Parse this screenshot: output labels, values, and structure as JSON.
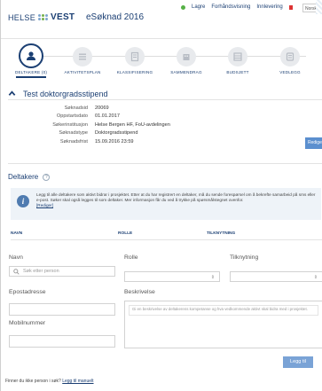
{
  "header": {
    "brand_left": "HELSE",
    "brand_right": "VEST",
    "app_title": "eSøknad 2016",
    "save": "Lagre",
    "preview": "Forhåndsvisning",
    "submit": "Innlevering",
    "language": "Norsk"
  },
  "steps": [
    {
      "label": "DELTAKERE (0)",
      "icon": "people-icon"
    },
    {
      "label": "AKTIVITETSPLAN",
      "icon": "list-icon"
    },
    {
      "label": "KLASSIFISERING",
      "icon": "document-icon"
    },
    {
      "label": "SAMMENDRAG",
      "icon": "building-icon"
    },
    {
      "label": "BUDSJETT",
      "icon": "table-icon"
    },
    {
      "label": "VEDLEGG",
      "icon": "attachment-icon"
    }
  ],
  "section": {
    "title": "Test doktorgradsstipend",
    "rows": [
      {
        "k": "Søknadsid",
        "v": "20069"
      },
      {
        "k": "Oppstartsdato",
        "v": "01.01.2017"
      },
      {
        "k": "Søkerinstitusjon",
        "v": "Helse Bergen HF, FoU-avdelingen"
      },
      {
        "k": "Søknadstype",
        "v": "Doktorgradsstipend"
      },
      {
        "k": "Søknadsfrist",
        "v": "15.09.2016 23:59"
      }
    ],
    "edit_button": "Rediger"
  },
  "participants": {
    "title": "Deltakere",
    "help": "?",
    "info_icon": "i",
    "info": "Legg til alle deltakere som aktivt bidrar i prosjektet. Etter at du har registrert en deltaker, må du sende forespørsel om å bekrefte samarbeid på sms eller e-post. Søker skal også legges til som deltaker. Mer informasjon får du ved å trykke på spørsmålstegnet ovenfor.",
    "info_link": "[Rediger]"
  },
  "table_headers": [
    "NAVN",
    "ROLLE",
    "TILKNYTNING"
  ],
  "form": {
    "name_label": "Navn",
    "name_placeholder": "Søk etter person",
    "role_label": "Rolle",
    "affiliation_label": "Tilknytning",
    "email_label": "Epostadresse",
    "phone_label": "Mobilnummer",
    "description_label": "Beskrivelse",
    "description_placeholder": "Gi en beskrivelse av deltakerens kompetanse og hva vedkommende aktivt skal bidra med i prosjektet.",
    "add_button": "Legg til"
  },
  "footer": {
    "text": "Finner du ikke person i søk?",
    "link": "Legg til manuelt"
  },
  "colors": {
    "brand": "#1b3f73",
    "accent": "#5b8fcf",
    "ok": "#56b146"
  }
}
